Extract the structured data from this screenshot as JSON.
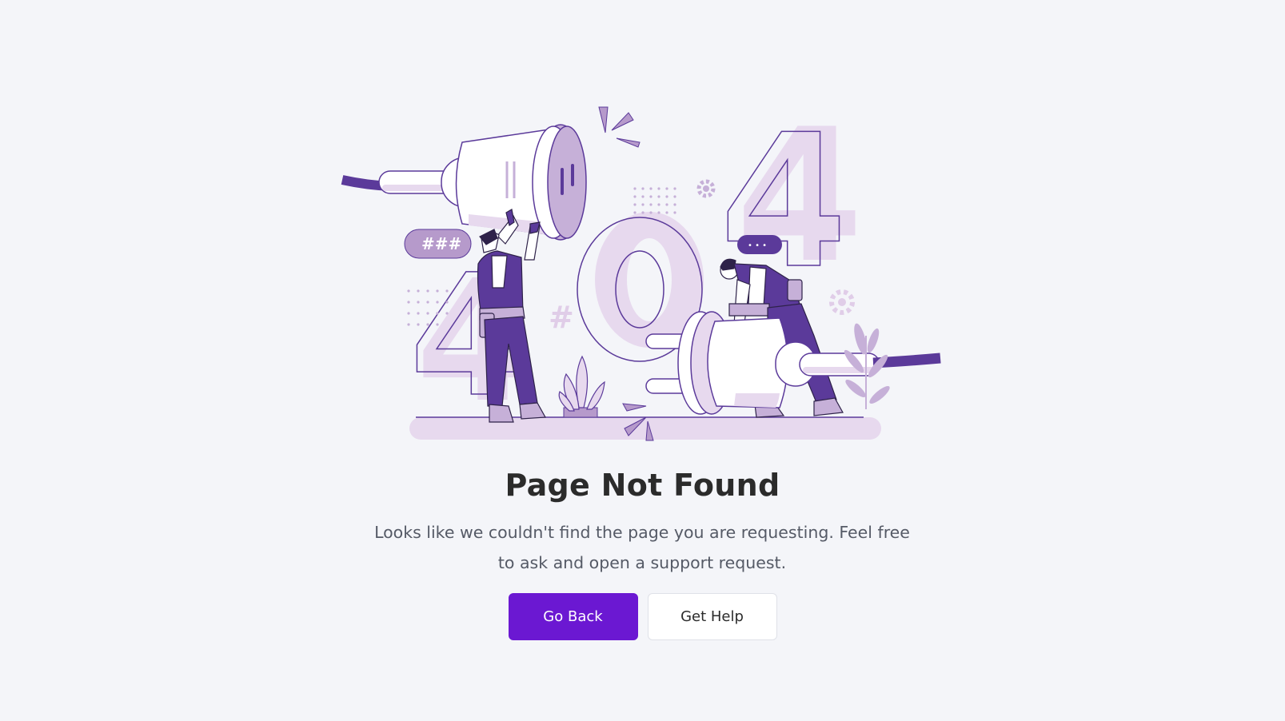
{
  "illustration": {
    "digits": [
      "4",
      "0",
      "4"
    ],
    "hash_bubble_text": "###",
    "hash_sign": "#",
    "chat_bubble_text": "• • •"
  },
  "error": {
    "title": "Page Not Found",
    "message": "Looks like we couldn't find the page you are requesting. Feel free to ask and open a support request."
  },
  "actions": {
    "go_back_label": "Go Back",
    "get_help_label": "Get Help"
  },
  "colors": {
    "background": "#f4f5f9",
    "primary": "#6b18d2",
    "illustration_purple": "#5b3a9a",
    "illustration_lilac": "#e7d9ee",
    "illustration_mid": "#c6b0d8"
  }
}
